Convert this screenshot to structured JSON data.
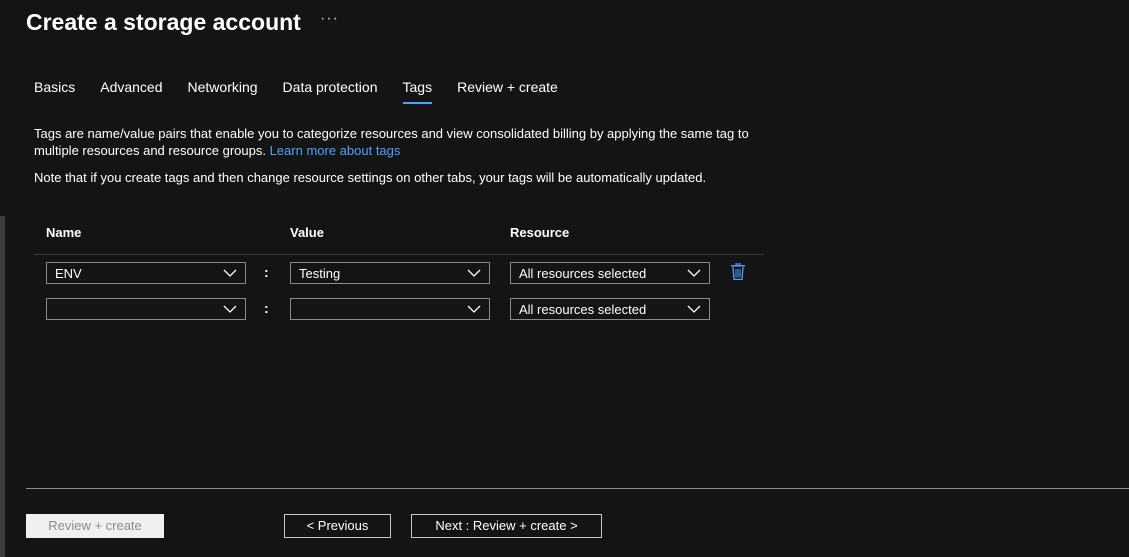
{
  "header": {
    "title": "Create a storage account",
    "more_label": "···"
  },
  "tabs": [
    {
      "label": "Basics"
    },
    {
      "label": "Advanced"
    },
    {
      "label": "Networking"
    },
    {
      "label": "Data protection"
    },
    {
      "label": "Tags",
      "active": true
    },
    {
      "label": "Review + create"
    }
  ],
  "description": {
    "text": "Tags are name/value pairs that enable you to categorize resources and view consolidated billing by applying the same tag to multiple resources and resource groups.",
    "link": "Learn more about tags",
    "note": "Note that if you create tags and then change resource settings on other tabs, your tags will be automatically updated."
  },
  "table": {
    "headers": {
      "name": "Name",
      "value": "Value",
      "resource": "Resource"
    },
    "separator": ":",
    "rows": [
      {
        "name": "ENV",
        "value": "Testing",
        "resource": "All resources selected"
      },
      {
        "name": "",
        "value": "",
        "resource": "All resources selected"
      }
    ]
  },
  "footer": {
    "review_create": "Review + create",
    "previous": "< Previous",
    "next": "Next : Review + create >"
  },
  "colors": {
    "background": "#141414",
    "accent": "#4fa1ff",
    "border": "#8a8a8a"
  }
}
